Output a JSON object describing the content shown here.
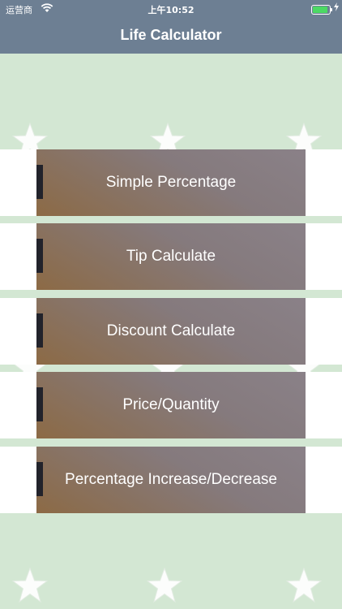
{
  "status_bar": {
    "carrier": "运营商",
    "time": "上午10:52",
    "battery_level": 1.0,
    "colors": {
      "battery": "#4cd964"
    }
  },
  "nav_bar": {
    "title": "Life Calculator",
    "background": "#6d7f93"
  },
  "background": {
    "color": "#d3e7d3",
    "decoration": "star-icon"
  },
  "menu": {
    "items": [
      {
        "label": "Simple Percentage"
      },
      {
        "label": "Tip Calculate"
      },
      {
        "label": "Discount Calculate"
      },
      {
        "label": "Price/Quantity"
      },
      {
        "label": "Percentage Increase/Decrease"
      }
    ]
  }
}
